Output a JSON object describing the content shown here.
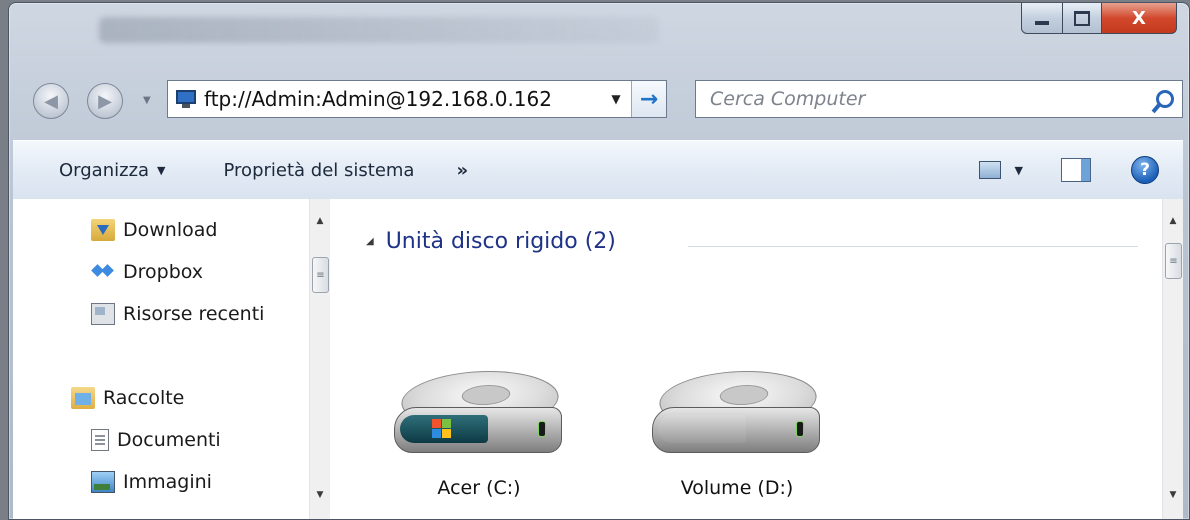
{
  "window": {
    "caption": {
      "minimize": "",
      "maximize": "",
      "close": "X"
    }
  },
  "address_bar": {
    "path": "ftp://Admin:Admin@192.168.0.162",
    "dropdown": "▼",
    "go": "→"
  },
  "search": {
    "placeholder": "Cerca Computer"
  },
  "toolbar": {
    "organize": "Organizza",
    "system_properties": "Proprietà del sistema",
    "more": "»",
    "help": "?"
  },
  "nav_pane": {
    "items": [
      {
        "label": "Download",
        "icon": "download-folder-icon"
      },
      {
        "label": "Dropbox",
        "icon": "dropbox-icon"
      },
      {
        "label": "Risorse recenti",
        "icon": "recent-places-icon"
      },
      {
        "label": "Raccolte",
        "icon": "libraries-icon"
      },
      {
        "label": "Documenti",
        "icon": "documents-icon"
      },
      {
        "label": "Immagini",
        "icon": "pictures-icon"
      }
    ]
  },
  "content": {
    "group_title": "Unità disco rigido (2)",
    "drives": [
      {
        "label": "Acer (C:)",
        "icon": "system-drive-icon"
      },
      {
        "label": "Volume (D:)",
        "icon": "hard-drive-icon"
      }
    ]
  }
}
